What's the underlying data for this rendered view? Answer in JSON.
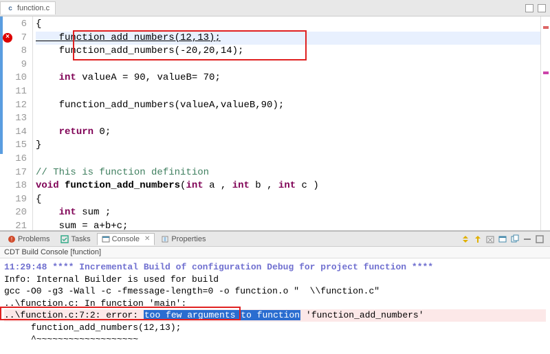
{
  "editor": {
    "tab_label": "function.c",
    "lines": [
      {
        "n": 6,
        "text": "{"
      },
      {
        "n": 7,
        "text": "    function_add_numbers(12,13);",
        "hl": true,
        "err": true,
        "underline": true
      },
      {
        "n": 8,
        "text": "    function_add_numbers(-20,20,14);"
      },
      {
        "n": 9,
        "text": ""
      },
      {
        "n": 10,
        "text": "    int valueA = 90, valueB= 70;",
        "kw": "int"
      },
      {
        "n": 11,
        "text": ""
      },
      {
        "n": 12,
        "text": "    function_add_numbers(valueA,valueB,90);"
      },
      {
        "n": 13,
        "text": ""
      },
      {
        "n": 14,
        "text": "    return 0;",
        "kw": "return"
      },
      {
        "n": 15,
        "text": "}"
      },
      {
        "n": 16,
        "text": ""
      },
      {
        "n": 17,
        "text": "// This is function definition",
        "cm": true
      },
      {
        "n": 18,
        "text": "void function_add_numbers(int a , int b , int c )",
        "sig": true
      },
      {
        "n": 19,
        "text": "{"
      },
      {
        "n": 20,
        "text": "    int sum ;",
        "kw": "int"
      },
      {
        "n": 21,
        "text": "    sum = a+b+c;"
      }
    ]
  },
  "bottom": {
    "tabs": {
      "problems": "Problems",
      "tasks": "Tasks",
      "console": "Console",
      "properties": "Properties"
    },
    "console_title": "CDT Build Console [function]",
    "console_lines": {
      "head": "11:29:48 **** Incremental Build of configuration Debug for project function ****",
      "info": "Info: Internal Builder is used for build",
      "gcc": "gcc -O0 -g3 -Wall -c -fmessage-length=0 -o function.o \"  \\\\function.c\"",
      "ctx": "..\\function.c: In function 'main':",
      "err_prefix": "..\\function.c:7:2: error: ",
      "err_sel": "too few arguments to function",
      "err_suffix": " 'function_add_numbers'",
      "call": "     function_add_numbers(12,13);",
      "caret": "     ^~~~~~~~~~~~~~~~~~~~"
    }
  }
}
